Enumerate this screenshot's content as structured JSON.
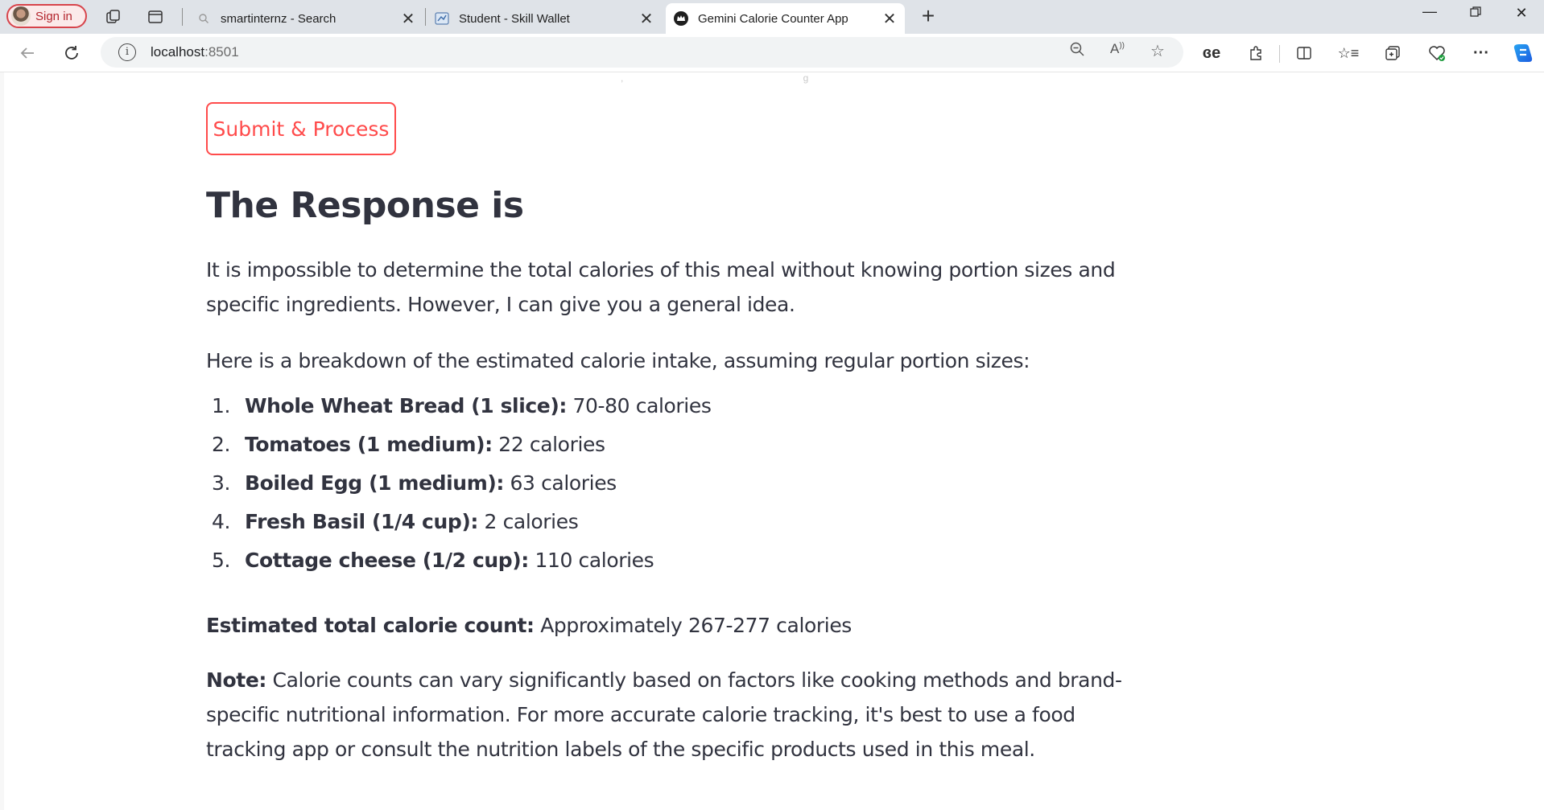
{
  "browser": {
    "profile_label": "Sign in",
    "tabs": [
      {
        "title": "smartinternz - Search",
        "active": false
      },
      {
        "title": "Student - Skill Wallet",
        "active": false
      },
      {
        "title": "Gemini Calorie Counter App",
        "active": true
      }
    ],
    "address": {
      "host": "localhost",
      "port": ":8501"
    }
  },
  "app": {
    "submit_label": "Submit & Process",
    "heading": "The Response is",
    "intro": "It is impossible to determine the total calories of this meal without knowing portion sizes and specific ingredients. However, I can give you a general idea.",
    "breakdown_intro": "Here is a breakdown of the estimated calorie intake, assuming regular portion sizes:",
    "items": [
      {
        "num": "1.",
        "name": "Whole Wheat Bread (1 slice):",
        "cal": " 70-80 calories"
      },
      {
        "num": "2.",
        "name": "Tomatoes (1 medium):",
        "cal": " 22 calories"
      },
      {
        "num": "3.",
        "name": "Boiled Egg (1 medium):",
        "cal": " 63 calories"
      },
      {
        "num": "4.",
        "name": "Fresh Basil (1/4 cup):",
        "cal": " 2 calories"
      },
      {
        "num": "5.",
        "name": "Cottage cheese (1/2 cup):",
        "cal": " 110 calories"
      }
    ],
    "total_label": "Estimated total calorie count:",
    "total_value": " Approximately 267-277 calories",
    "note_label": "Note:",
    "note_text": " Calorie counts can vary significantly based on factors like cooking methods and brand-specific nutritional information. For more accurate calorie tracking, it's best to use a food tracking app or consult the nutrition labels of the specific products used in this meal.",
    "accent_color": "#ff4b4b"
  }
}
